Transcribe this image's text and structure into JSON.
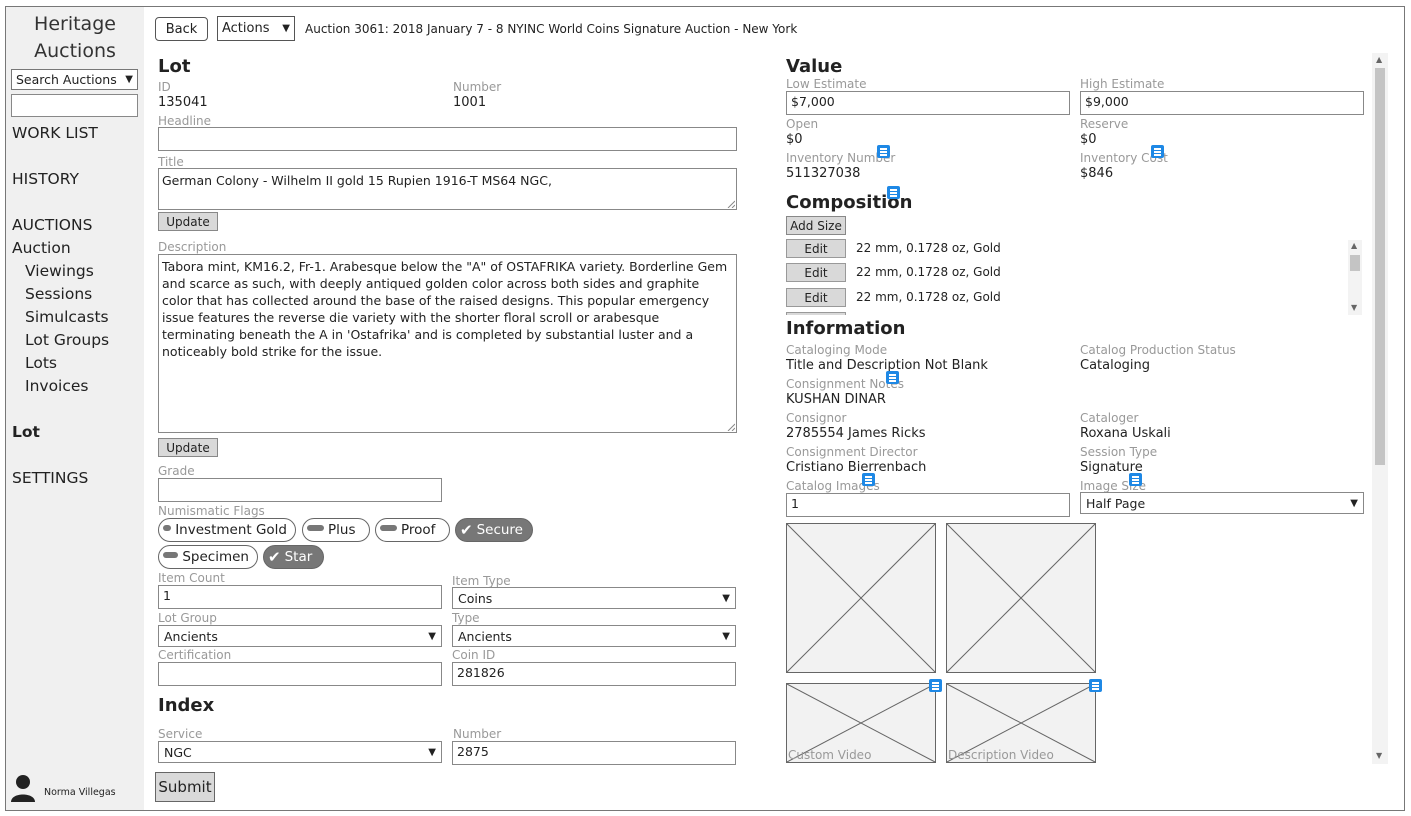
{
  "sidebar": {
    "brand_line1": "Heritage",
    "brand_line2": "Auctions",
    "search_select": "Search Auctions",
    "search_value": "",
    "nav": {
      "work_list": "WORK LIST",
      "history": "HISTORY",
      "auctions": "AUCTIONS",
      "auction": "Auction",
      "viewings": "Viewings",
      "sessions": "Sessions",
      "simulcasts": "Simulcasts",
      "lot_groups": "Lot Groups",
      "lots": "Lots",
      "invoices": "Invoices",
      "lot": "Lot",
      "settings": "SETTINGS"
    },
    "user_name": "Norma Villegas"
  },
  "toolbar": {
    "back_label": "Back",
    "actions_label": "Actions",
    "auction_title": "Auction 3061: 2018 January 7 - 8 NYINC World Coins Signature Auction - New York"
  },
  "lot": {
    "heading": "Lot",
    "id_label": "ID",
    "id_value": "135041",
    "number_label": "Number",
    "number_value": "1001",
    "headline_label": "Headline",
    "headline_value": "",
    "title_label": "Title",
    "title_value": "German Colony - Wilhelm II gold 15 Rupien 1916-T MS64 NGC,",
    "update_label": "Update",
    "description_label": "Description",
    "description_value": "Tabora mint, KM16.2, Fr-1. Arabesque below the \"A\" of OSTAFRIKA variety. Borderline Gem and scarce as such, with deeply antiqued golden color across both sides and graphite color that has collected around the base of the raised designs. This popular emergency issue features the reverse die variety with the shorter floral scroll or arabesque terminating beneath the A in 'Ostafrika'  and is completed by substantial luster and a noticeably bold strike for the issue.",
    "update2_label": "Update",
    "grade_label": "Grade",
    "grade_value": "",
    "flags_label": "Numismatic Flags",
    "flags": [
      {
        "label": "Investment Gold",
        "on": false
      },
      {
        "label": "Plus",
        "on": false
      },
      {
        "label": "Proof",
        "on": false
      },
      {
        "label": "Secure",
        "on": true
      },
      {
        "label": "Specimen",
        "on": false
      },
      {
        "label": "Star",
        "on": true
      }
    ],
    "item_count_label": "Item Count",
    "item_count_value": "1",
    "item_type_label": "Item Type",
    "item_type_value": "Coins",
    "lot_group_label": "Lot Group",
    "lot_group_value": "Ancients",
    "type_label": "Type",
    "type_value": "Ancients",
    "certification_label": "Certification",
    "certification_value": "",
    "coin_id_label": "Coin ID",
    "coin_id_value": "281826"
  },
  "index": {
    "heading": "Index",
    "service_label": "Service",
    "service_value": "NGC",
    "number_label": "Number",
    "number_value": "2875"
  },
  "submit_label": "Submit",
  "value": {
    "heading": "Value",
    "low_label": "Low Estimate",
    "low_value": "$7,000",
    "high_label": "High Estimate",
    "high_value": "$9,000",
    "open_label": "Open",
    "open_value": "$0",
    "reserve_label": "Reserve",
    "reserve_value": "$0",
    "inv_number_label": "Inventory Number",
    "inv_number_value": "511327038",
    "inv_cost_label": "Inventory Cost",
    "inv_cost_value": "$846"
  },
  "composition": {
    "heading": "Composition",
    "add_size_label": "Add Size",
    "edit_label": "Edit",
    "rows": [
      "22 mm, 0.1728 oz, Gold",
      "22 mm, 0.1728 oz, Gold",
      "22 mm, 0.1728 oz, Gold"
    ]
  },
  "information": {
    "heading": "Information",
    "cataloging_mode_label": "Cataloging Mode",
    "cataloging_mode_value": "Title and Description Not Blank",
    "catalog_prod_status_label": "Catalog Production Status",
    "catalog_prod_status_value": "Cataloging",
    "consignment_notes_label": "Consignment Notes",
    "consignment_notes_value": "KUSHAN DINAR",
    "consignor_label": "Consignor",
    "consignor_value": "2785554 James Ricks",
    "cataloger_label": "Cataloger",
    "cataloger_value": "Roxana Uskali",
    "consignment_director_label": "Consignment Director",
    "consignment_director_value": "Cristiano Bierrenbach",
    "session_type_label": "Session Type",
    "session_type_value": "Signature",
    "catalog_images_label": "Catalog Images",
    "catalog_images_value": "1",
    "image_size_label": "Image Size",
    "image_size_value": "Half Page",
    "custom_video_label": "Custom Video",
    "description_video_label": "Description Video"
  },
  "colors": {
    "note_icon": "#1e88e5",
    "sidebar_bg": "#f0f0f0",
    "toggle_on": "#777777"
  }
}
